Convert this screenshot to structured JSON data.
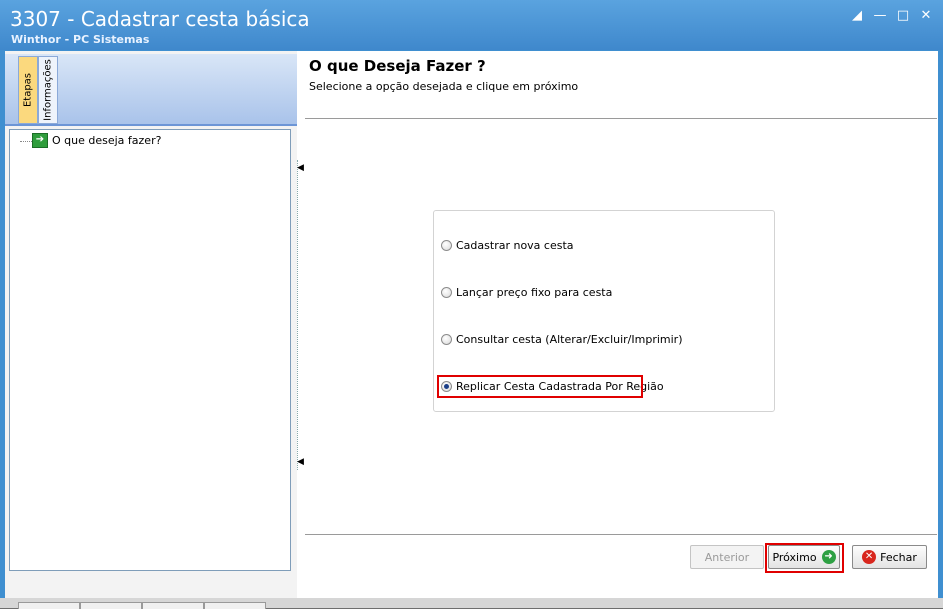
{
  "window": {
    "title": "3307 - Cadastrar cesta básica",
    "subtitle": "Winthor - PC Sistemas"
  },
  "left_panel": {
    "tabs": [
      "Etapas",
      "Informações"
    ],
    "active_tab": "Etapas",
    "tree_items": [
      {
        "label": "O que deseja fazer?",
        "icon": "green-arrow-icon"
      }
    ]
  },
  "main": {
    "heading": "O que Deseja Fazer ?",
    "instruction": "Selecione a opção desejada e clique em próximo",
    "options": [
      {
        "label": "Cadastrar nova cesta",
        "checked": false
      },
      {
        "label": "Lançar preço fixo para cesta",
        "checked": false
      },
      {
        "label": "Consultar cesta (Alterar/Excluir/Imprimir)",
        "checked": false
      },
      {
        "label": "Replicar Cesta Cadastrada Por Região",
        "checked": true
      }
    ]
  },
  "footer": {
    "anterior": "Anterior",
    "proximo": "Próximo",
    "fechar": "Fechar"
  },
  "colors": {
    "titlebar": "#3f88cc",
    "highlight": "#e00000",
    "active_tab": "#fbd97e"
  }
}
